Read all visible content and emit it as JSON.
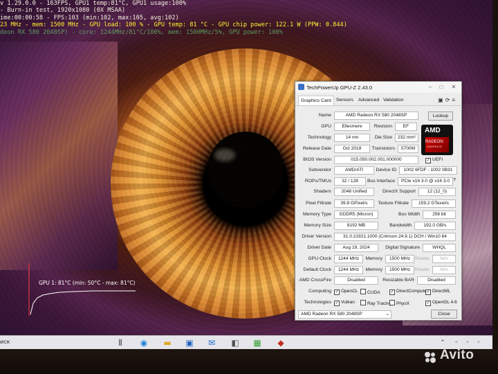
{
  "osd": {
    "line1": "v 1.29.0.0 - 163FPS, GPU1 temp:81°C, GPU1 usage:100%",
    "line2": "- Burn-in test, 1920x1080 (0X MSAA)",
    "line3": "ime:00:00:58 - FPS:103 (min:102, max:105, avg:102)",
    "line4": "23 MHz - mem: 1500 MHz - GPU load: 100 % - GPU temp: 81 °C - GPU chip power: 122.1 W (PPW: 0.844)",
    "line5": "deon RX 580 2048SP) - core: 1244MHz/81°C/100%, mem: 1500MHz/5%, GPU power: 100%"
  },
  "temp_graph": {
    "label": "GPU 1: 81°C (min: 50°C - max: 81°C)",
    "min": 50,
    "max": 81,
    "current": 81
  },
  "gpuz": {
    "title": "TechPowerUp GPU-Z 2.43.0",
    "tabs": [
      "Graphics Card",
      "Sensors",
      "Advanced",
      "Validation"
    ],
    "labels": {
      "name": "Name",
      "gpu": "GPU",
      "revision": "Revision",
      "technology": "Technology",
      "die_size": "Die Size",
      "release_date": "Release Date",
      "transistors": "Transistors",
      "bios": "BIOS Version",
      "subvendor": "Subvendor",
      "device_id": "Device ID",
      "rops": "ROPs/TMUs",
      "bus_interface": "Bus Interface",
      "shaders": "Shaders",
      "directx": "DirectX Support",
      "pixel_fillrate": "Pixel Fillrate",
      "texture_fillrate": "Texture Fillrate",
      "memory_type": "Memory Type",
      "bus_width": "Bus Width",
      "memory_size": "Memory Size",
      "bandwidth": "Bandwidth",
      "driver_version": "Driver Version",
      "driver_date": "Driver Date",
      "digital_signature": "Digital Signature",
      "gpu_clock": "GPU Clock",
      "memory": "Memory",
      "shader": "Shader",
      "default_clock": "Default Clock",
      "crossfire": "AMD CrossFire",
      "resizable_bar": "Resizable BAR",
      "computing": "Computing",
      "technologies": "Technologies"
    },
    "values": {
      "name": "AMD Radeon RX 580 2048SP",
      "gpu": "Ellesmere",
      "revision": "EF",
      "technology": "14 nm",
      "die_size": "232 mm²",
      "release_date": "Oct 2018",
      "transistors": "5700M",
      "bios": "015.050.002.001.000000",
      "uefi": "UEFI",
      "subvendor": "AMD/ATI",
      "device_id": "1002 6FDF - 1002 0B31",
      "rops": "32 / 128",
      "bus_interface": "PCIe x16 3.0 @ x16 3.0",
      "shaders": "2048 Unified",
      "directx": "12 (12_0)",
      "pixel_fillrate": "39.8 GPixel/s",
      "texture_fillrate": "159.2 GTexel/s",
      "memory_type": "GDDR5 (Micron)",
      "bus_width": "256 bit",
      "memory_size": "8192 MB",
      "bandwidth": "192.0 GB/s",
      "driver_version": "31.0.21921.1000 (Crimson 24.9.1) DCH / Win10 64",
      "driver_date": "Aug 19, 2024",
      "digital_signature": "WHQL",
      "gpu_clock": "1244 MHz",
      "memory_clock": "1500 MHz",
      "shader_clock": "N/A",
      "default_gpu_clock": "1244 MHz",
      "default_memory_clock": "1500 MHz",
      "default_shader_clock": "N/A",
      "crossfire": "Disabled",
      "resizable_bar": "Disabled"
    },
    "computing": [
      "OpenCL",
      "CUDA",
      "DirectCompute",
      "DirectML"
    ],
    "computing_checked": [
      true,
      false,
      true,
      true
    ],
    "technologies": [
      "Vulkan",
      "Ray Tracing",
      "PhysX",
      "OpenGL 4.6"
    ],
    "technologies_checked": [
      true,
      false,
      false,
      true
    ],
    "lookup_label": "Lookup",
    "selected_card": "AMD Radeon RX 580 2048SP",
    "close_label": "Close",
    "badge": {
      "brand": "AMD",
      "line1": "RADEON",
      "line2": "GRAPHICS"
    }
  },
  "taskbar": {
    "search_text": "иск"
  },
  "watermark": "Avito"
}
